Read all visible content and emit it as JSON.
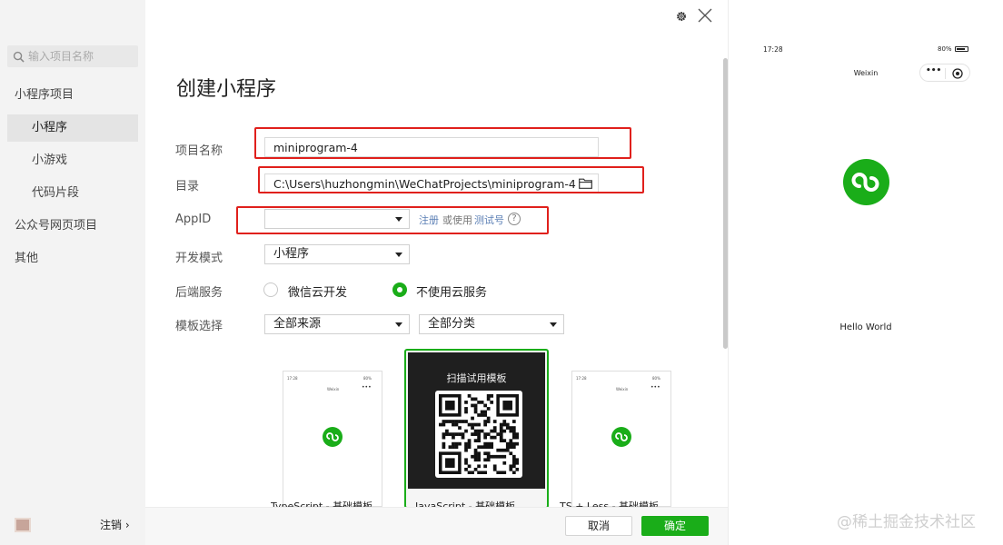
{
  "sidebar": {
    "search_placeholder": "输入项目名称",
    "items": [
      {
        "label": "小程序项目"
      },
      {
        "label": "小程序"
      },
      {
        "label": "小游戏"
      },
      {
        "label": "代码片段"
      },
      {
        "label": "公众号网页项目"
      },
      {
        "label": "其他"
      }
    ],
    "logout_label": "注销 ›"
  },
  "main": {
    "title": "创建小程序",
    "fields": {
      "project_name_label": "项目名称",
      "project_name_value": "miniprogram-4",
      "directory_label": "目录",
      "directory_value": "C:\\Users\\huzhongmin\\WeChatProjects\\miniprogram-4",
      "appid_label": "AppID",
      "appid_value": "",
      "register_link": "注册",
      "or_use_text": "或使用",
      "test_account_link": "测试号",
      "help_glyph": "?",
      "dev_mode_label": "开发模式",
      "dev_mode_value": "小程序",
      "backend_label": "后端服务",
      "backend_option_cloud": "微信云开发",
      "backend_option_none": "不使用云服务",
      "backend_selected": "不使用云服务",
      "template_label": "模板选择",
      "template_source_value": "全部来源",
      "template_category_value": "全部分类"
    },
    "templates": [
      {
        "label": "TypeScript - 基础模板",
        "mini_time": "17:28",
        "mini_battery": "80%",
        "mini_nav": "Weixin"
      },
      {
        "label": "JavaScript - 基础模板",
        "scan_title": "扫描试用模板"
      },
      {
        "label": "TS + Less - 基础模板",
        "mini_time": "17:28",
        "mini_battery": "80%",
        "mini_nav": "Weixin"
      }
    ],
    "buttons": {
      "cancel": "取消",
      "confirm": "确定"
    }
  },
  "preview": {
    "time": "17:28",
    "battery": "80%",
    "nav_title": "Weixin",
    "content": "Hello World"
  },
  "watermark": "@稀土掘金技术社区",
  "colors": {
    "accent_green": "#1aad19",
    "highlight_red": "#e0201c",
    "link_blue": "#5b7fb5",
    "sidebar_bg": "#f3f3f3"
  },
  "icons": [
    "search-icon",
    "gear-icon",
    "close-icon",
    "folder-icon",
    "help-icon",
    "miniprogram-logo-icon",
    "more-icon",
    "target-icon",
    "battery-icon",
    "qr-code-icon"
  ]
}
